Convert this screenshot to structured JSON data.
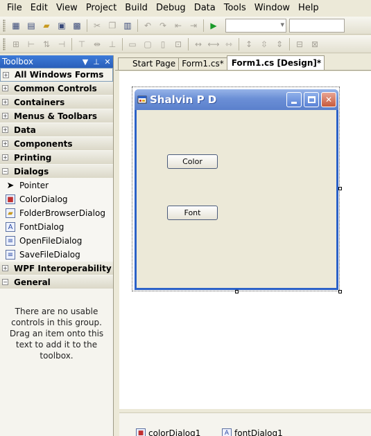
{
  "menu": [
    "File",
    "Edit",
    "View",
    "Project",
    "Build",
    "Debug",
    "Data",
    "Tools",
    "Window",
    "Help"
  ],
  "toolbox": {
    "title": "Toolbox",
    "categories": {
      "all_windows_forms": "All Windows Forms",
      "common_controls": "Common Controls",
      "containers": "Containers",
      "menus_toolbars": "Menus & Toolbars",
      "data": "Data",
      "components": "Components",
      "printing": "Printing",
      "dialogs": "Dialogs",
      "wpf_interop": "WPF Interoperability",
      "general": "General"
    },
    "dialog_items": [
      "Pointer",
      "ColorDialog",
      "FolderBrowserDialog",
      "FontDialog",
      "OpenFileDialog",
      "SaveFileDialog"
    ],
    "empty_message": "There are no usable controls in this group. Drag an item onto this text to add it to the toolbox."
  },
  "tabs": [
    "Start Page",
    "Form1.cs*",
    "Form1.cs [Design]*"
  ],
  "form": {
    "title": "Shalvin P D",
    "color_button": "Color",
    "font_button": "Font"
  },
  "tray": [
    "colorDialog1",
    "fontDialog1"
  ],
  "colors": {
    "titlebar": "#2b61c8",
    "toolbox_header": "#3d7bd9",
    "face": "#ece9d8"
  }
}
